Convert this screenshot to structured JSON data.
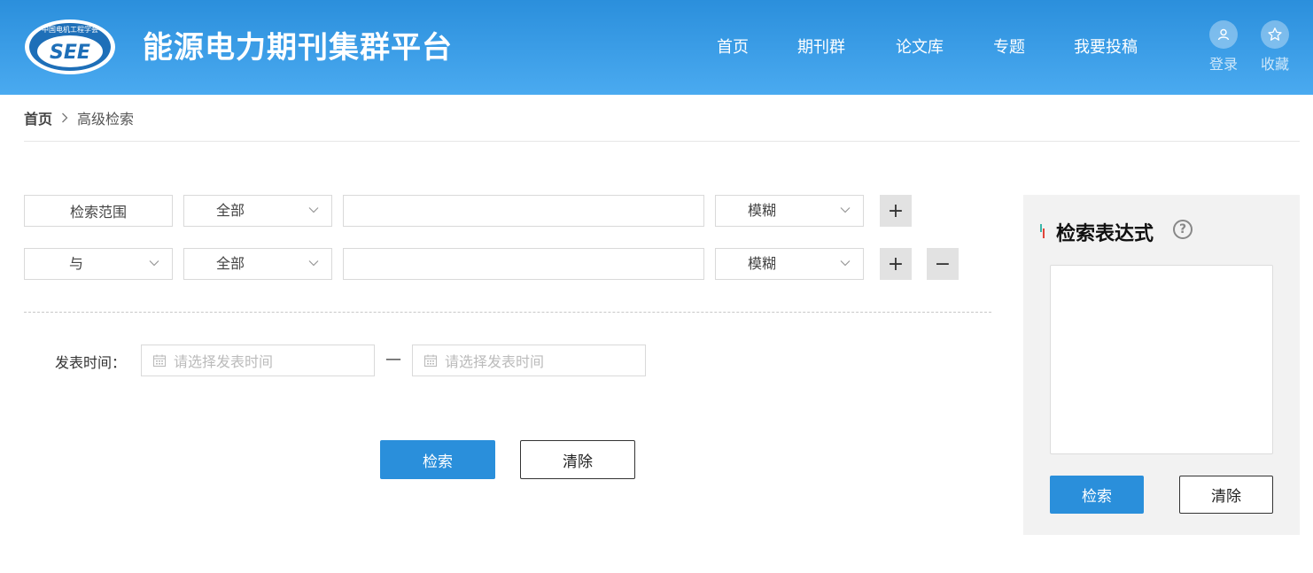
{
  "header": {
    "title": "能源电力期刊集群平台",
    "logo_text": "SEE",
    "logo_arc_text": "中国电机工程学会",
    "nav": [
      "首页",
      "期刊群",
      "论文库",
      "专题",
      "我要投稿"
    ],
    "login_label": "登录",
    "favorite_label": "收藏"
  },
  "breadcrumb": {
    "home": "首页",
    "current": "高级检索"
  },
  "search": {
    "scope_label": "检索范围",
    "row1": {
      "field": "全部",
      "value": "",
      "match": "模糊"
    },
    "row2": {
      "logic": "与",
      "field": "全部",
      "value": "",
      "match": "模糊"
    },
    "add_symbol": "+",
    "remove_symbol": "−",
    "time_label": "发表时间：",
    "date_start_placeholder": "请选择发表时间",
    "date_end_placeholder": "请选择发表时间",
    "time_separator": "—",
    "search_button": "检索",
    "clear_button": "清除"
  },
  "expression_panel": {
    "title": "检索表达式",
    "help_symbol": "?",
    "value": "",
    "search_button": "检索",
    "clear_button": "清除"
  },
  "colors": {
    "header_start": "#2b8fdc",
    "header_end": "#4aaaf0",
    "primary": "#2a8fdb",
    "panel_bg": "#f2f2f2"
  }
}
